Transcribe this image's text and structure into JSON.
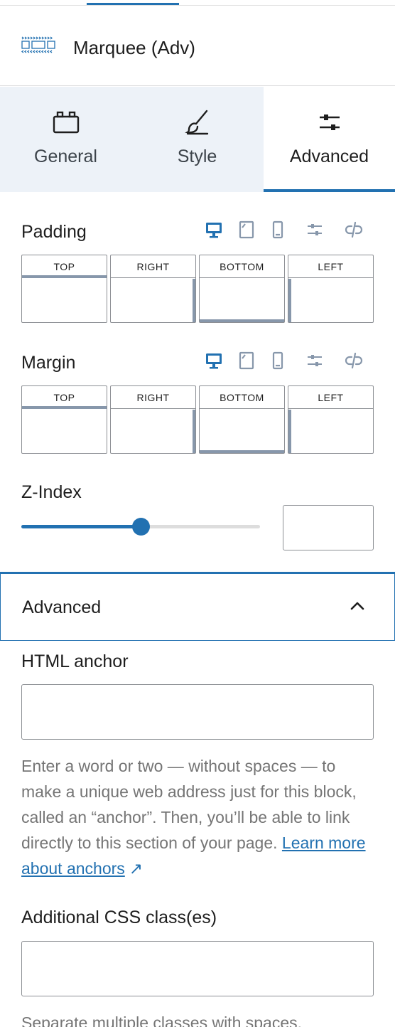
{
  "block": {
    "title": "Marquee (Adv)",
    "icon": "marquee-block-icon"
  },
  "tabs": [
    {
      "label": "General",
      "icon": "general-tab-icon",
      "active": false
    },
    {
      "label": "Style",
      "icon": "brush-icon",
      "active": false
    },
    {
      "label": "Advanced",
      "icon": "sliders-icon",
      "active": true
    }
  ],
  "padding": {
    "label": "Padding",
    "sides": [
      {
        "label": "TOP",
        "value": ""
      },
      {
        "label": "RIGHT",
        "value": ""
      },
      {
        "label": "BOTTOM",
        "value": ""
      },
      {
        "label": "LEFT",
        "value": ""
      }
    ]
  },
  "margin": {
    "label": "Margin",
    "sides": [
      {
        "label": "TOP",
        "value": ""
      },
      {
        "label": "RIGHT",
        "value": ""
      },
      {
        "label": "BOTTOM",
        "value": ""
      },
      {
        "label": "LEFT",
        "value": ""
      }
    ]
  },
  "device_icons": [
    "desktop-icon",
    "tablet-icon",
    "mobile-icon",
    "sliders-icon",
    "unlink-icon"
  ],
  "zindex": {
    "label": "Z-Index",
    "slider_fraction": 0.5,
    "value": ""
  },
  "advanced_panel": {
    "title": "Advanced",
    "expanded": true,
    "html_anchor": {
      "label": "HTML anchor",
      "value": "",
      "help": "Enter a word or two — without spaces — to make a unique web address just for this block, called an “anchor”. Then, you’ll be able to link directly to this section of your page.",
      "link_text": "Learn more about anchors",
      "link_icon": "↗"
    },
    "css_classes": {
      "label": "Additional CSS class(es)",
      "value": "",
      "help": "Separate multiple classes with spaces."
    }
  },
  "colors": {
    "accent": "#2271b1",
    "tab_bg": "#edf2f8",
    "help_text": "#757575",
    "border": "#8c8f94"
  }
}
